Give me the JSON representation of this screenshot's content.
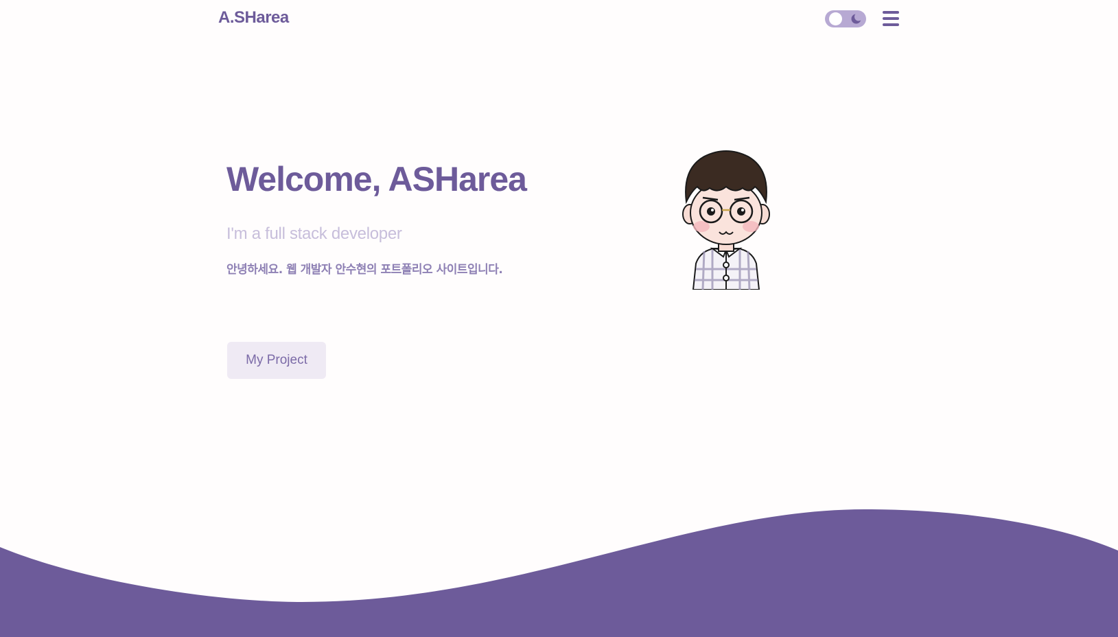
{
  "header": {
    "logo": "A.SHarea"
  },
  "hero": {
    "title": "Welcome, ASHarea",
    "subtitle": "I'm a full stack developer",
    "description": "안녕하세요. 웹 개발자 안수현의 포트폴리오 사이트입니다.",
    "button_label": "My Project"
  },
  "theme": {
    "mode": "light",
    "toggle_icon": "moon-icon"
  },
  "icons": {
    "menu": "hamburger-menu-icon",
    "avatar": "developer-avatar"
  },
  "colors": {
    "primary": "#6d5b9a",
    "subtitle": "#c7bedb",
    "description": "#8e80b4",
    "button_bg": "#efeaf4",
    "button_text": "#7b6aa7",
    "toggle_bg": "#b7a9d3",
    "background": "#fffdfd",
    "wave": "#6d5b9a"
  }
}
